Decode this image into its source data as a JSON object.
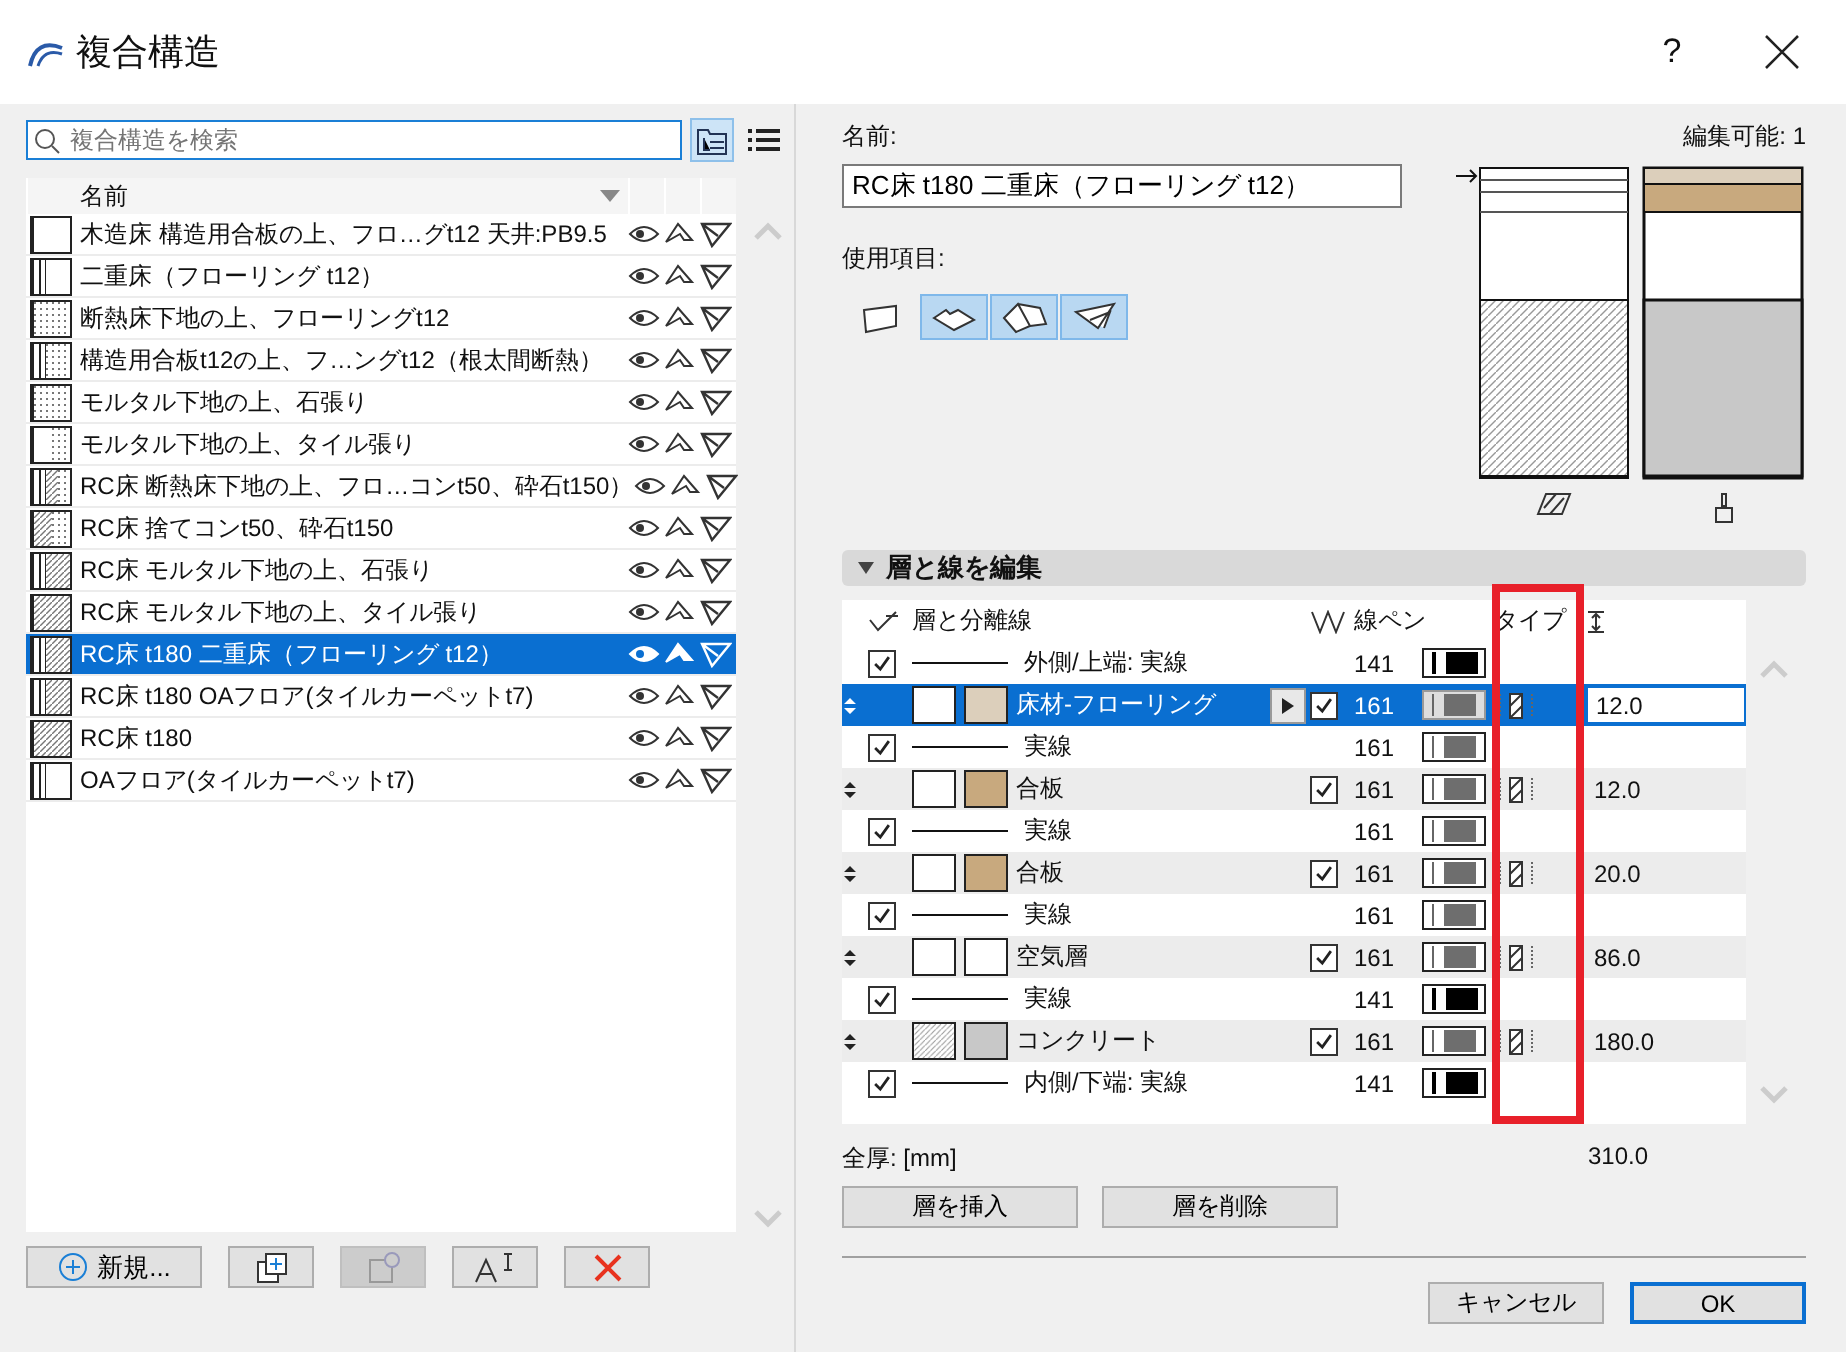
{
  "window": {
    "title": "複合構造",
    "help": "?"
  },
  "search": {
    "placeholder": "複合構造を検索"
  },
  "list": {
    "columns": [
      "名前"
    ],
    "items": [
      {
        "name": "木造床 構造用合板の上、フロ…グt12 天井:PB9.5",
        "kind": "plain",
        "selected": false
      },
      {
        "name": "二重床（フローリング t12）",
        "kind": "lined",
        "selected": false
      },
      {
        "name": "断熱床下地の上、フローリングt12",
        "kind": "dotted",
        "selected": false
      },
      {
        "name": "構造用合板t12の上、フ…ングt12（根太間断熱）",
        "kind": "linedotted",
        "selected": false
      },
      {
        "name": "モルタル下地の上、石張り",
        "kind": "speckled",
        "selected": false
      },
      {
        "name": "モルタル下地の上、タイル張り",
        "kind": "halfdotted",
        "selected": false
      },
      {
        "name": "RC床 断熱床下地の上、フロ…コンt50、砕石t150）",
        "kind": "layered",
        "selected": false
      },
      {
        "name": "RC床 捨てコンt50、砕石t150",
        "kind": "gravel",
        "selected": false
      },
      {
        "name": "RC床 モルタル下地の上、石張り",
        "kind": "linehatched",
        "selected": false
      },
      {
        "name": "RC床 モルタル下地の上、タイル張り",
        "kind": "hatched",
        "selected": false
      },
      {
        "name": "RC床 t180 二重床（フローリング t12）",
        "kind": "linehatched",
        "selected": true
      },
      {
        "name": "RC床 t180 OAフロア(タイルカーペットt7)",
        "kind": "linehatched",
        "selected": false
      },
      {
        "name": "RC床 t180",
        "kind": "hatched",
        "selected": false
      },
      {
        "name": "OAフロア(タイルカーペットt7)",
        "kind": "lined",
        "selected": false
      }
    ]
  },
  "list_buttons": [
    {
      "label": "新規...",
      "kind": "new",
      "disabled": false
    },
    {
      "kind": "duplicate",
      "disabled": false
    },
    {
      "kind": "folder",
      "disabled": true
    },
    {
      "kind": "rename",
      "disabled": false
    },
    {
      "kind": "delete",
      "disabled": false
    }
  ],
  "name_label": "名前:",
  "name_value": "RC床 t180 二重床（フローリング t12）",
  "editable": "編集可能: 1",
  "usage_label": "使用項目:",
  "usage": [
    {
      "kind": "wall",
      "selected": false
    },
    {
      "kind": "slab",
      "selected": true
    },
    {
      "kind": "roof",
      "selected": true
    },
    {
      "kind": "shell",
      "selected": true
    }
  ],
  "section": {
    "title": "層と線を編集",
    "expanded": true
  },
  "table": {
    "columns": [
      "層と分離線",
      "線ペン",
      "タイプ"
    ],
    "rows": [
      {
        "kind": "line",
        "label": "外側/上端: 実線",
        "checked": true,
        "pen": "141",
        "heavy": true
      },
      {
        "kind": "layer",
        "label": "床材-フローリング",
        "color": "#dccfbb",
        "hatched": false,
        "checked": true,
        "pen": "161",
        "thickness": "12.0",
        "selected": true
      },
      {
        "kind": "line",
        "label": "実線",
        "checked": true,
        "pen": "161",
        "heavy": false
      },
      {
        "kind": "layer",
        "label": "合板",
        "color": "#c8a97e",
        "hatched": false,
        "checked": true,
        "pen": "161",
        "thickness": "12.0",
        "selected": false
      },
      {
        "kind": "line",
        "label": "実線",
        "checked": true,
        "pen": "161",
        "heavy": false
      },
      {
        "kind": "layer",
        "label": "合板",
        "color": "#c8a97e",
        "hatched": false,
        "checked": true,
        "pen": "161",
        "thickness": "20.0",
        "selected": false
      },
      {
        "kind": "line",
        "label": "実線",
        "checked": true,
        "pen": "161",
        "heavy": false
      },
      {
        "kind": "layer",
        "label": "空気層",
        "color": "#ffffff",
        "hatched": false,
        "checked": true,
        "pen": "161",
        "thickness": "86.0",
        "selected": false
      },
      {
        "kind": "line",
        "label": "実線",
        "checked": true,
        "pen": "141",
        "heavy": true
      },
      {
        "kind": "layer",
        "label": "コンクリート",
        "color": "#c8c8c8",
        "hatched": true,
        "checked": true,
        "pen": "161",
        "thickness": "180.0",
        "selected": false
      },
      {
        "kind": "line",
        "label": "内側/下端: 実線",
        "checked": true,
        "pen": "141",
        "heavy": true
      }
    ]
  },
  "total": {
    "label": "全厚: [mm]",
    "value": "310.0"
  },
  "layer_buttons": [
    "層を挿入",
    "層を削除"
  ],
  "dialog_buttons": [
    {
      "label": "キャンセル",
      "default": false
    },
    {
      "label": "OK",
      "default": true
    }
  ]
}
